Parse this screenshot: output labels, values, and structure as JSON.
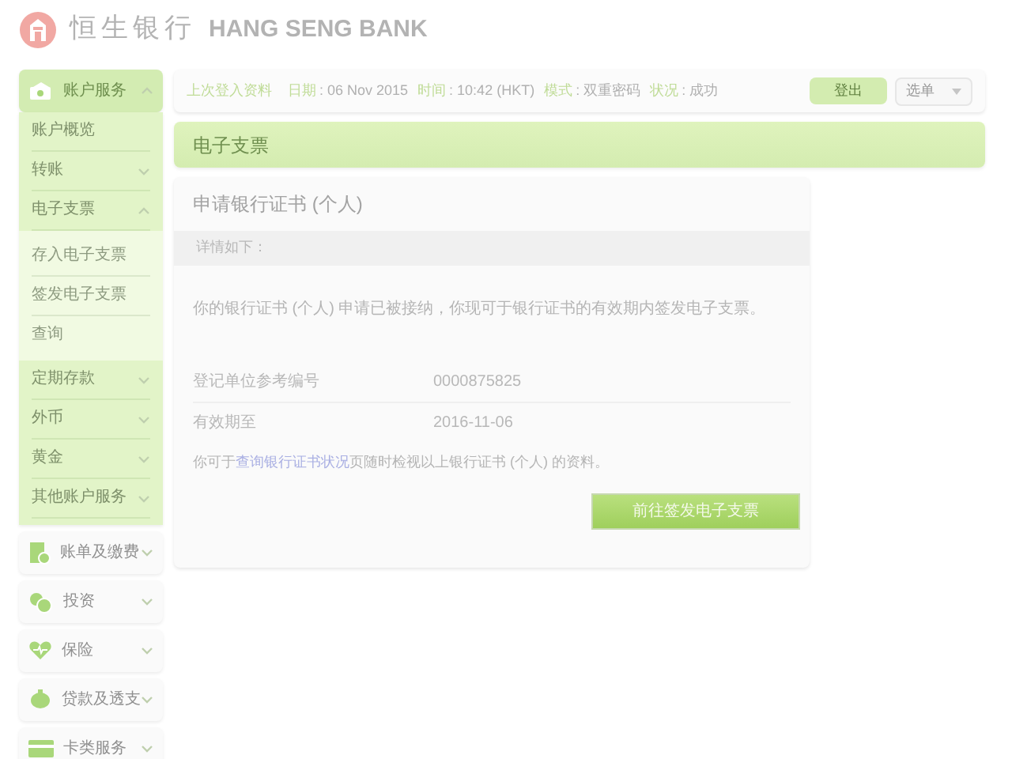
{
  "header": {
    "logo_cn": "恒生银行",
    "logo_en": "HANG SENG BANK"
  },
  "sidebar": {
    "groups": [
      {
        "label": "账户服务",
        "expanded": true,
        "children": [
          {
            "label": "账户概览"
          },
          {
            "label": "转账",
            "expanded": false
          },
          {
            "label": "电子支票",
            "expanded": true,
            "children": [
              {
                "label": "存入电子支票"
              },
              {
                "label": "签发电子支票"
              },
              {
                "label": "查询"
              }
            ]
          },
          {
            "label": "定期存款",
            "expanded": false
          },
          {
            "label": "外币",
            "expanded": false
          },
          {
            "label": "黄金",
            "expanded": false
          },
          {
            "label": "其他账户服务",
            "expanded": false
          }
        ]
      },
      {
        "label": "账单及缴费",
        "expanded": false
      },
      {
        "label": "投资",
        "expanded": false
      },
      {
        "label": "保险",
        "expanded": false
      },
      {
        "label": "贷款及透支",
        "expanded": false
      },
      {
        "label": "卡类服务",
        "expanded": false
      }
    ]
  },
  "login_bar": {
    "title": "上次登入资料",
    "fields": [
      {
        "label": "日期",
        "value": ": 06 Nov 2015"
      },
      {
        "label": "时间",
        "value": ": 10:42 (HKT)"
      },
      {
        "label": "模式",
        "value": ": 双重密码"
      },
      {
        "label": "状况",
        "value": ": 成功"
      }
    ],
    "logout": "登出",
    "menu": "选单"
  },
  "section_title": "电子支票",
  "card": {
    "title": "申请银行证书 (个人)",
    "subheader": "详情如下：",
    "message": "你的银行证书 (个人) 申请已被接纳，你现可于银行证书的有效期内签发电子支票。",
    "details": [
      {
        "label": "登记单位参考编号",
        "value": "0000875825"
      },
      {
        "label": "有效期至",
        "value": "2016-11-06"
      }
    ],
    "note_before": "你可于",
    "note_link": "查询银行证书状况",
    "note_after": "页随时检视以上银行证书 (个人) 的资料。",
    "action": "前往签发电子支票"
  }
}
